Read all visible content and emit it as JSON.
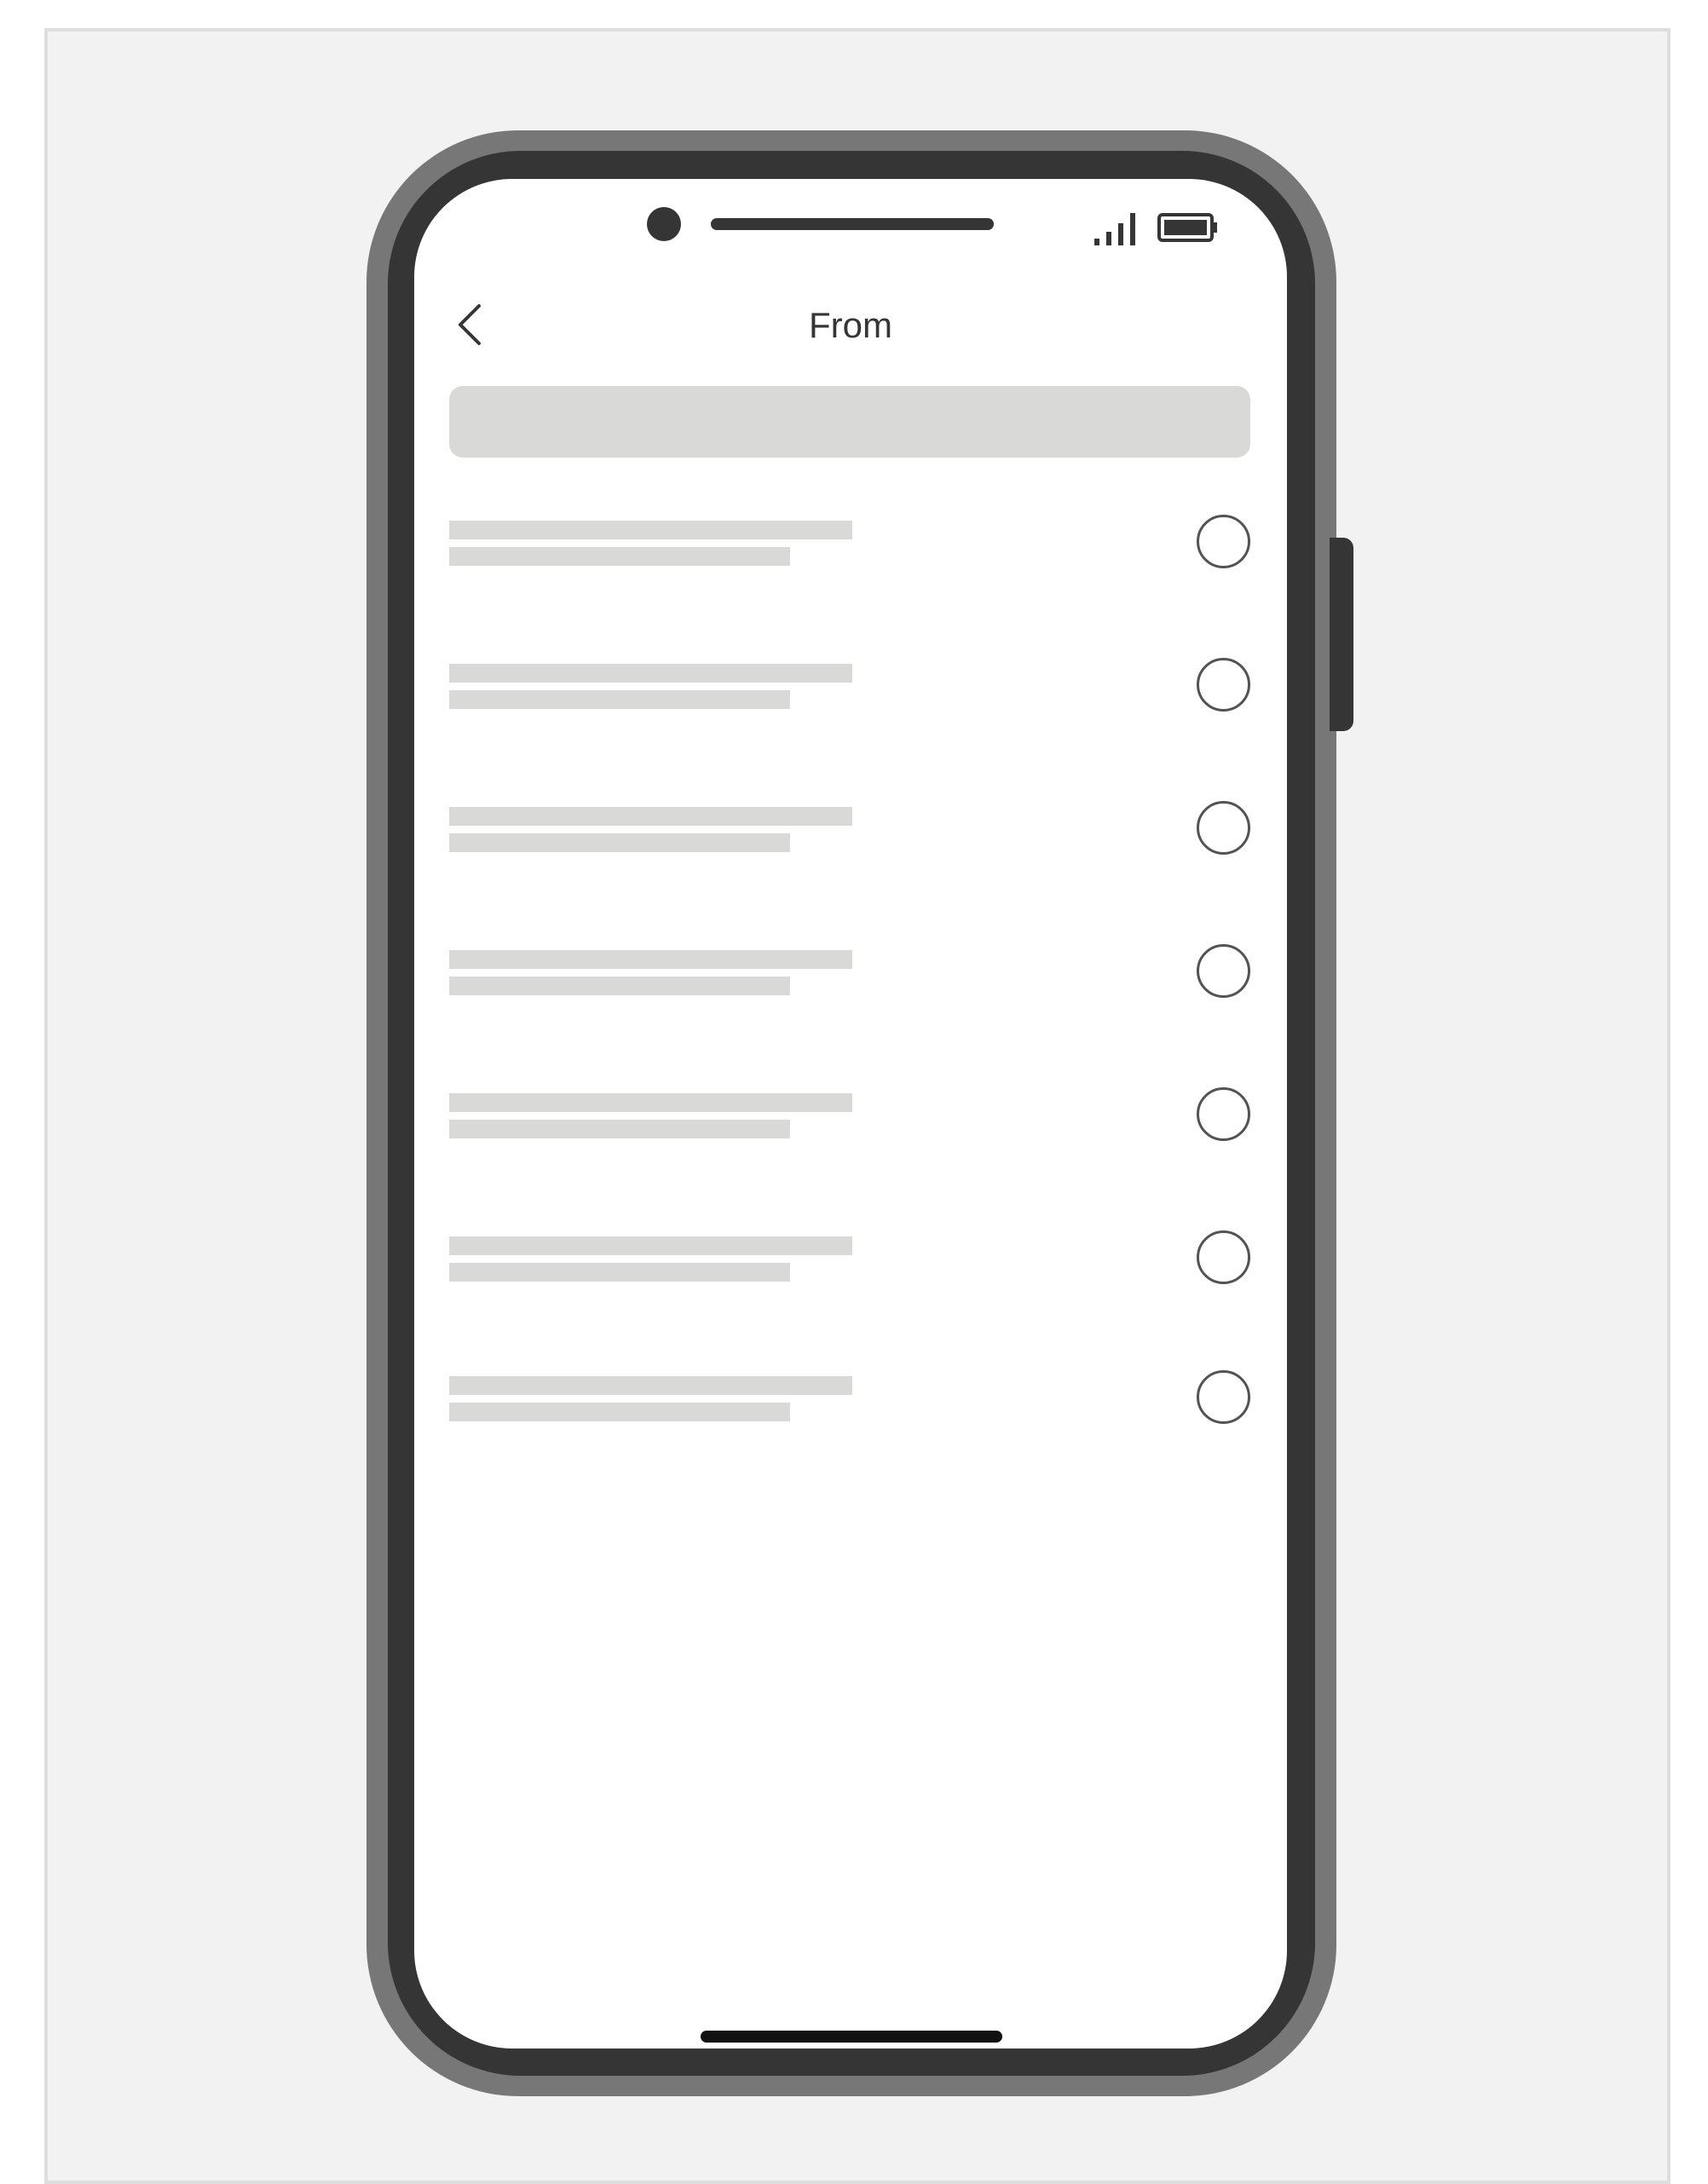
{
  "header": {
    "title": "From",
    "back_icon": "chevron-left-icon"
  },
  "search": {
    "placeholder": "",
    "value": ""
  },
  "status_bar": {
    "signal_icon": "signal-bars-icon",
    "battery_icon": "battery-icon"
  },
  "list": {
    "item_count": 7,
    "items": [
      {
        "label": "",
        "sublabel": "",
        "selected": false
      },
      {
        "label": "",
        "sublabel": "",
        "selected": false
      },
      {
        "label": "",
        "sublabel": "",
        "selected": false
      },
      {
        "label": "",
        "sublabel": "",
        "selected": false
      },
      {
        "label": "",
        "sublabel": "",
        "selected": false
      },
      {
        "label": "",
        "sublabel": "",
        "selected": false
      },
      {
        "label": "",
        "sublabel": "",
        "selected": false
      }
    ]
  },
  "colors": {
    "frame_outer": "#777777",
    "frame_inner": "#353535",
    "placeholder": "#d9d9d8",
    "background": "#f2f2f2",
    "text": "#353535"
  }
}
